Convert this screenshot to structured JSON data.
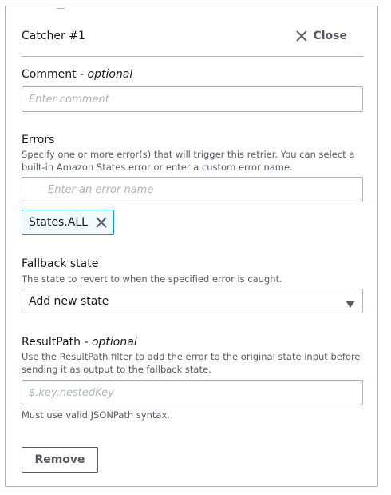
{
  "catcher": {
    "title": "Catcher #1",
    "close_label": "Close"
  },
  "comment": {
    "label": "Comment",
    "optional": "optional",
    "placeholder": "Enter comment",
    "value": ""
  },
  "errors": {
    "label": "Errors",
    "description": "Specify one or more error(s) that will trigger this retrier. You can select a built-in Amazon States error or enter a custom error name.",
    "search_placeholder": "Enter an error name",
    "tokens": [
      "States.ALL"
    ]
  },
  "fallback": {
    "label": "Fallback state",
    "description": "The state to revert to when the specified error is caught.",
    "selected": "Add new state"
  },
  "result_path": {
    "label": "ResultPath",
    "optional": "optional",
    "description": "Use the ResultPath filter to add the error to the original state input before sending it as output to the fallback state.",
    "placeholder": "$.key.nestedKey",
    "hint": "Must use valid JSONPath syntax.",
    "value": ""
  },
  "remove_label": "Remove",
  "icons": {
    "close": "close-icon",
    "search": "search-icon",
    "token_remove": "close-icon",
    "dropdown": "caret-down-icon"
  },
  "colors": {
    "border": "#aab7b8",
    "token_border": "#00a1c9",
    "token_bg": "#f1faff",
    "text_secondary": "#545b64"
  }
}
